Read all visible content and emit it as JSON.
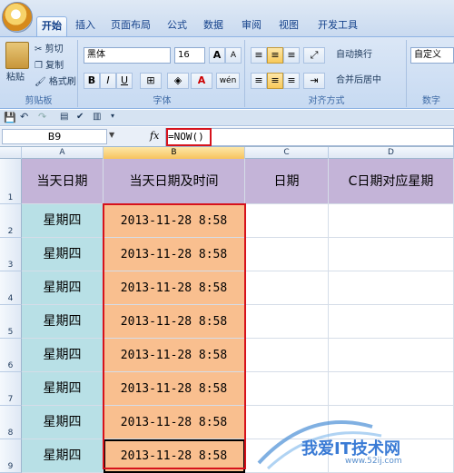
{
  "ribbon_tabs": [
    "开始",
    "插入",
    "页面布局",
    "公式",
    "数据",
    "审阅",
    "视图",
    "开发工具"
  ],
  "clipboard": {
    "paste": "粘贴",
    "cut": "剪切",
    "copy": "复制",
    "format_painter": "格式刷",
    "label": "剪贴板"
  },
  "font": {
    "name": "黑体",
    "size": "16",
    "grow": "A",
    "shrink": "A",
    "bold": "B",
    "italic": "I",
    "underline": "U",
    "font_color": "A",
    "phonetic": "wén",
    "label": "字体"
  },
  "alignment": {
    "wrap": "自动换行",
    "merge": "合并后居中",
    "label": "对齐方式"
  },
  "number": {
    "format": "自定义",
    "label": "数字"
  },
  "name_box": "B9",
  "fx_symbol": "fx",
  "formula": "=NOW()",
  "columns": [
    "A",
    "B",
    "C",
    "D"
  ],
  "rows": [
    "1",
    "2",
    "3",
    "4",
    "5",
    "6",
    "7",
    "8",
    "9"
  ],
  "headers": [
    "当天日期",
    "当天日期及时间",
    "日期",
    "C日期对应星期"
  ],
  "data_rows": [
    {
      "a": "星期四",
      "b": "2013-11-28  8:58"
    },
    {
      "a": "星期四",
      "b": "2013-11-28  8:58"
    },
    {
      "a": "星期四",
      "b": "2013-11-28  8:58"
    },
    {
      "a": "星期四",
      "b": "2013-11-28  8:58"
    },
    {
      "a": "星期四",
      "b": "2013-11-28  8:58"
    },
    {
      "a": "星期四",
      "b": "2013-11-28  8:58"
    },
    {
      "a": "星期四",
      "b": "2013-11-28  8:58"
    },
    {
      "a": "星期四",
      "b": "2013-11-28  8:58"
    }
  ],
  "watermark": {
    "text": "我爱IT技术网",
    "url": "www.52ij.com"
  },
  "colors": {
    "header_bg": "#c4b4d8",
    "col_a_bg": "#b8e0e6",
    "col_b_bg": "#f9bf8f",
    "highlight": "#d6121c"
  }
}
